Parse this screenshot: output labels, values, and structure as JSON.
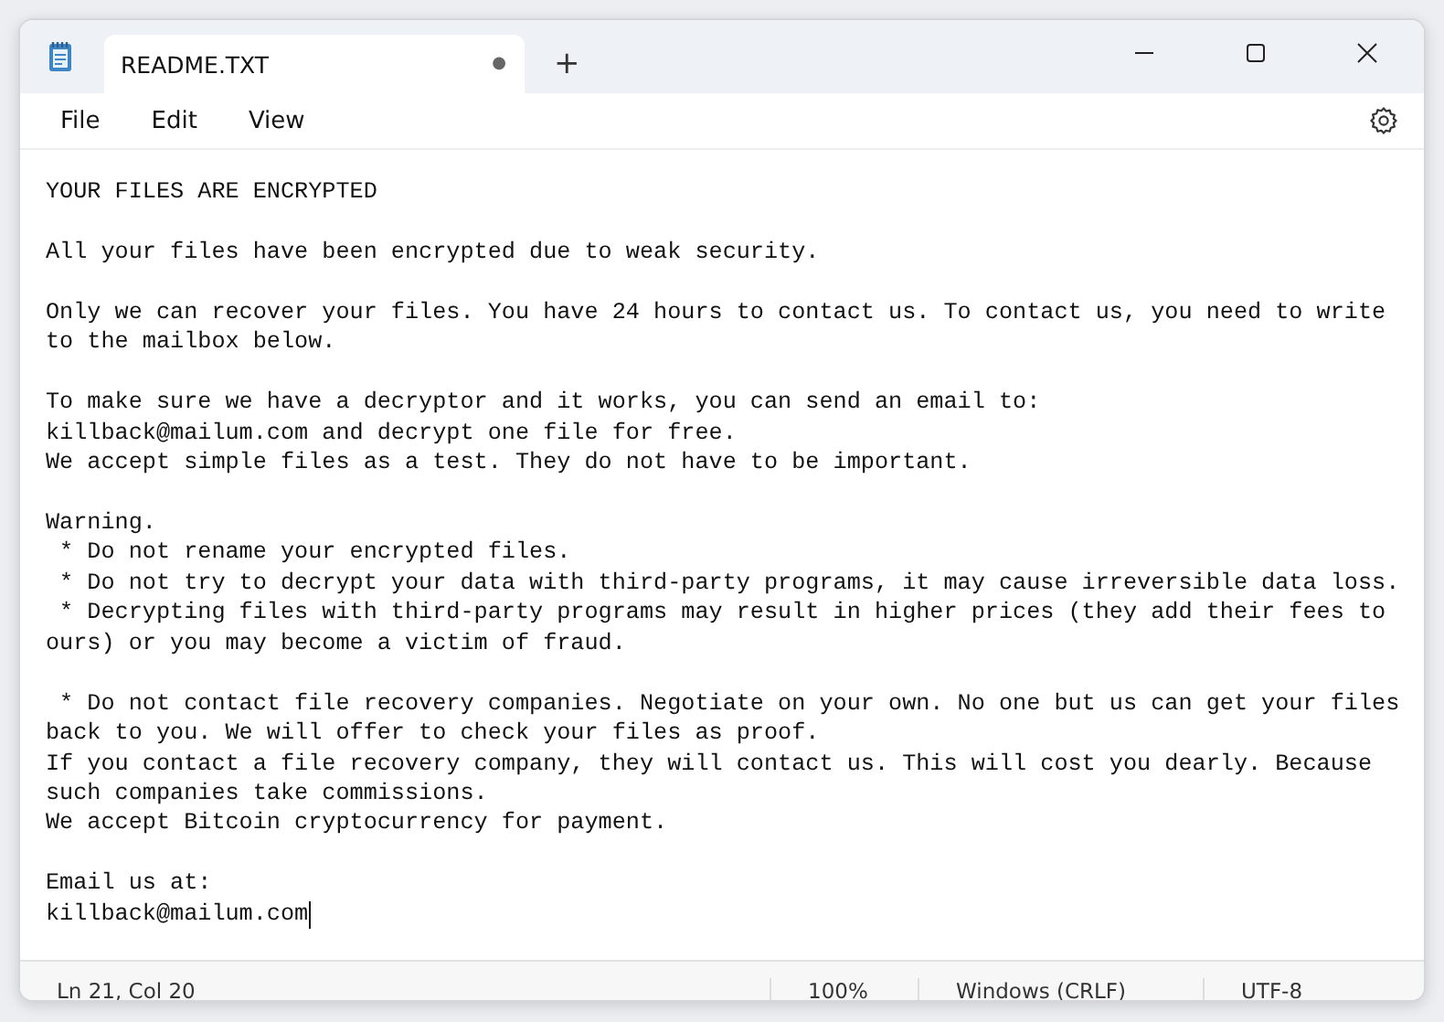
{
  "window": {
    "tab": {
      "title": "README.TXT",
      "modified_mark": "●",
      "selected": true
    },
    "new_tab": "+"
  },
  "menu": [
    "File",
    "Edit",
    "View"
  ],
  "document": {
    "paragraphs": [
      [
        "YOUR FILES ARE ENCRYPTED"
      ],
      [
        "All your files have been encrypted due to weak security."
      ],
      [
        "Only we can recover your files. You have 24 hours to contact us. To contact us, you need to write",
        "to the mailbox below."
      ],
      [
        "To make sure we have a decryptor and it works, you can send an email to:",
        "killback@mailum.com and decrypt one file for free.",
        "We accept simple files as a test. They do not have to be important."
      ],
      [
        "Warning.",
        " * Do not rename your encrypted files.",
        " * Do not try to decrypt your data with third-party programs, it may cause irreversible data loss.",
        " * Decrypting files with third-party programs may result in higher prices (they add their fees to",
        "ours) or you may become a victim of fraud."
      ],
      [
        " * Do not contact file recovery companies. Negotiate on your own. No one but us can get your files",
        "back to you. We will offer to check your files as proof.",
        "If you contact a file recovery company, they will contact us. This will cost you dearly. Because",
        "such companies take commissions.",
        "We accept Bitcoin cryptocurrency for payment."
      ],
      [
        "Email us at:",
        "killback@mailum.com"
      ]
    ]
  },
  "status_bar": {
    "position": "Ln 21, Col 20",
    "zoom": "100%",
    "line_ending": "Windows (CRLF)",
    "encoding": "UTF-8"
  }
}
